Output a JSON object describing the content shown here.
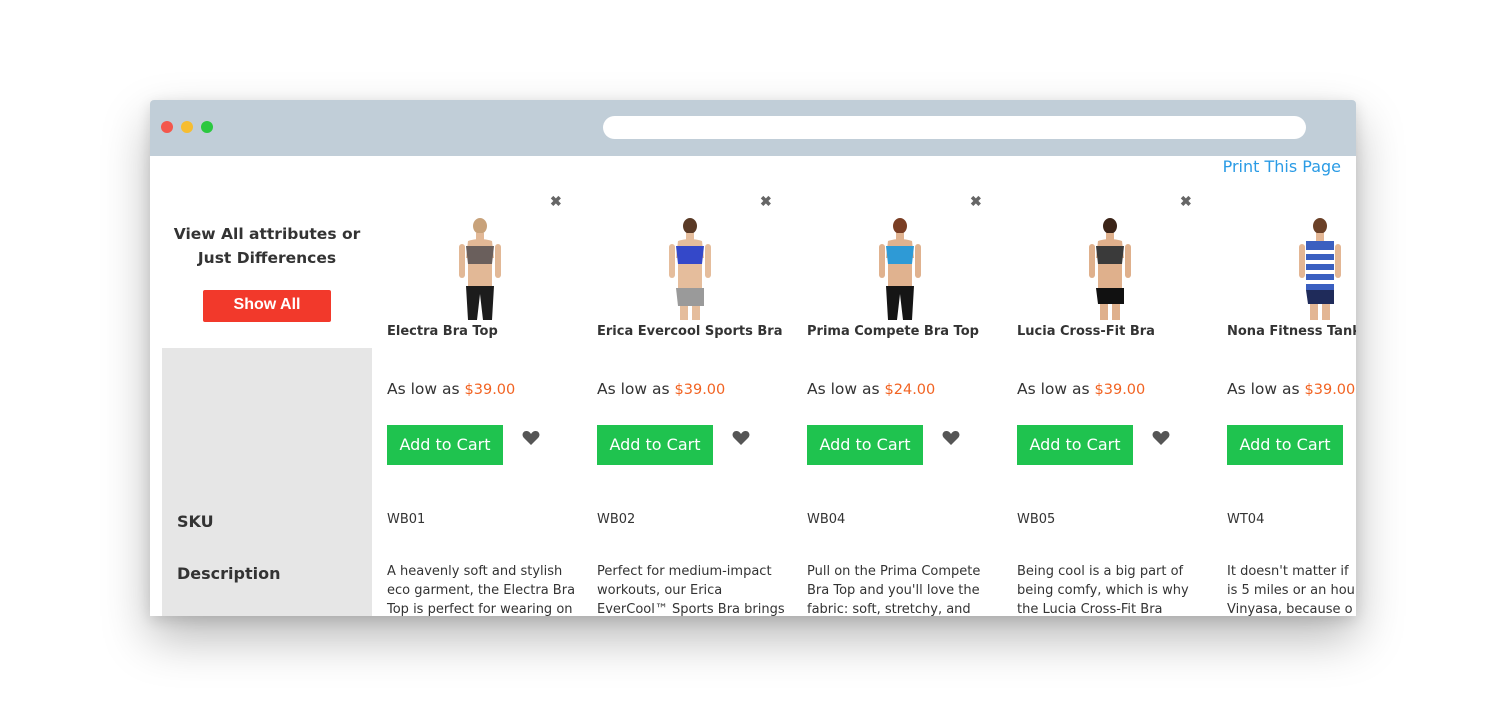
{
  "page": {
    "print_link": "Print This Page",
    "view_all_line1": "View All attributes or",
    "view_all_line2": "Just Differences",
    "show_all_button": "Show All",
    "labels": {
      "sku": "SKU",
      "description": "Description"
    },
    "remove_glyph": "✖",
    "price_prefix": "As low as",
    "add_to_cart": "Add to Cart"
  },
  "products": [
    {
      "name": "Electra Bra Top",
      "price": "$39.00",
      "sku": "WB01",
      "desc1": "A heavenly soft and stylish",
      "desc2": "eco garment, the Electra Bra",
      "desc3": "Top is perfect for wearing on"
    },
    {
      "name": "Erica Evercool Sports Bra",
      "price": "$39.00",
      "sku": "WB02",
      "desc1": "Perfect for medium-impact",
      "desc2": "workouts, our Erica",
      "desc3": "EverCool™ Sports Bra brings"
    },
    {
      "name": "Prima Compete Bra Top",
      "price": "$24.00",
      "sku": "WB04",
      "desc1": "Pull on the Prima Compete",
      "desc2": "Bra Top and you'll love the",
      "desc3": "fabric: soft, stretchy, and"
    },
    {
      "name": "Lucia Cross-Fit Bra",
      "price": "$39.00",
      "sku": "WB05",
      "desc1": "Being cool is a big part of",
      "desc2": "being comfy, which is why",
      "desc3": "the Lucia Cross-Fit Bra"
    },
    {
      "name": "Nona Fitness Tank",
      "price": "$39.00",
      "sku": "WT04",
      "desc1": "It doesn't matter if",
      "desc2": "is 5 miles or an hou",
      "desc3": "Vinyasa, because o"
    }
  ],
  "colors": {
    "accent_red": "#f2392b",
    "add_to_cart_green": "#1fc34f",
    "price_orange": "#f26322",
    "link_blue": "#2a9be5"
  }
}
